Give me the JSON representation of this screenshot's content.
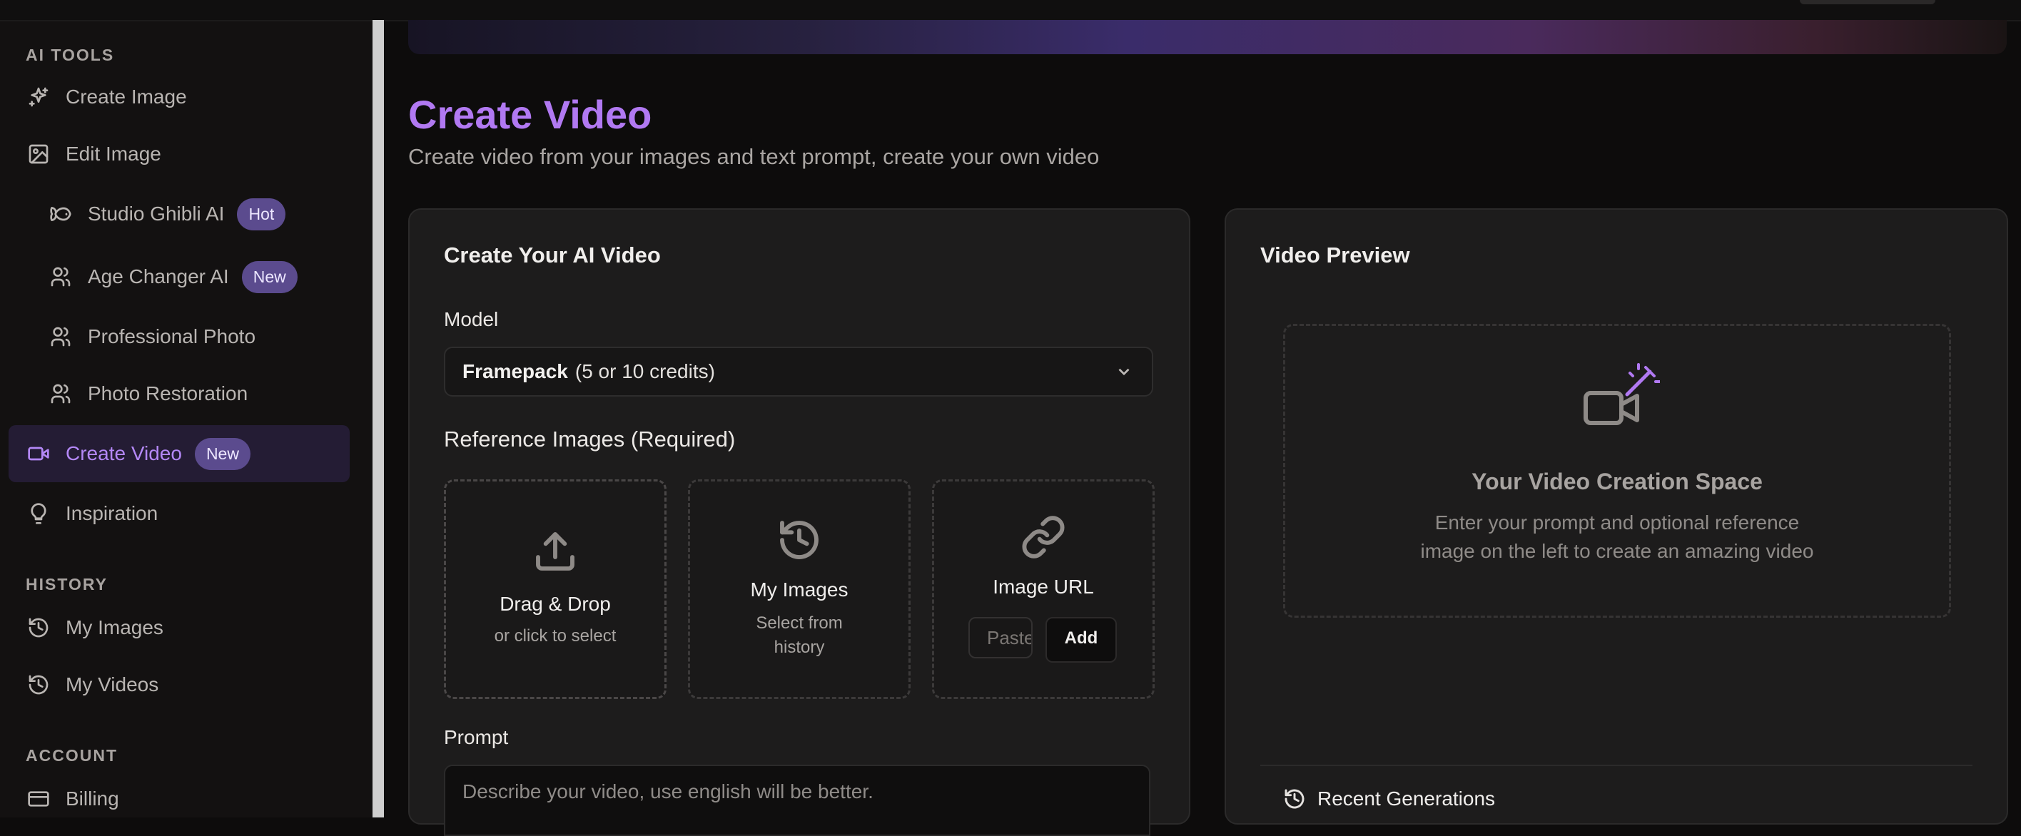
{
  "sidebar": {
    "sections": {
      "ai_tools": "AI TOOLS",
      "history": "HISTORY",
      "account": "ACCOUNT"
    },
    "items": [
      {
        "label": "Create Image",
        "icon": "sparkles-icon"
      },
      {
        "label": "Edit Image",
        "icon": "image-icon"
      },
      {
        "label": "Studio Ghibli AI",
        "icon": "fish-icon",
        "badge": "Hot"
      },
      {
        "label": "Age Changer AI",
        "icon": "users-icon",
        "badge": "New"
      },
      {
        "label": "Professional Photo",
        "icon": "users-icon"
      },
      {
        "label": "Photo Restoration",
        "icon": "users-icon"
      },
      {
        "label": "Create Video",
        "icon": "video-icon",
        "badge": "New",
        "active": true
      },
      {
        "label": "Inspiration",
        "icon": "lightbulb-icon"
      },
      {
        "label": "My Images",
        "icon": "history-icon"
      },
      {
        "label": "My Videos",
        "icon": "history-icon"
      },
      {
        "label": "Billing",
        "icon": "credit-card-icon"
      }
    ]
  },
  "page": {
    "title": "Create Video",
    "subtitle": "Create video from your images and text prompt, create your own video"
  },
  "form": {
    "title": "Create Your AI Video",
    "model_label": "Model",
    "model_name": "Framepack",
    "model_credits": "(5 or 10 credits)",
    "ref_label": "Reference Images (Required)",
    "drag_title": "Drag & Drop",
    "drag_sub": "or click to select",
    "myimages_title": "My Images",
    "myimages_sub": "Select from history",
    "url_title": "Image URL",
    "url_placeholder": "Paste",
    "url_add": "Add",
    "prompt_label": "Prompt",
    "prompt_placeholder": "Describe your video, use english will be better."
  },
  "preview": {
    "title": "Video Preview",
    "empty_title": "Your Video Creation Space",
    "empty_text": "Enter your prompt and optional reference image on the left to create an amazing video",
    "recent": "Recent Generations"
  },
  "colors": {
    "accent": "#b179f2",
    "badge_bg": "#5b4b8e",
    "active_bg": "#241c34"
  }
}
